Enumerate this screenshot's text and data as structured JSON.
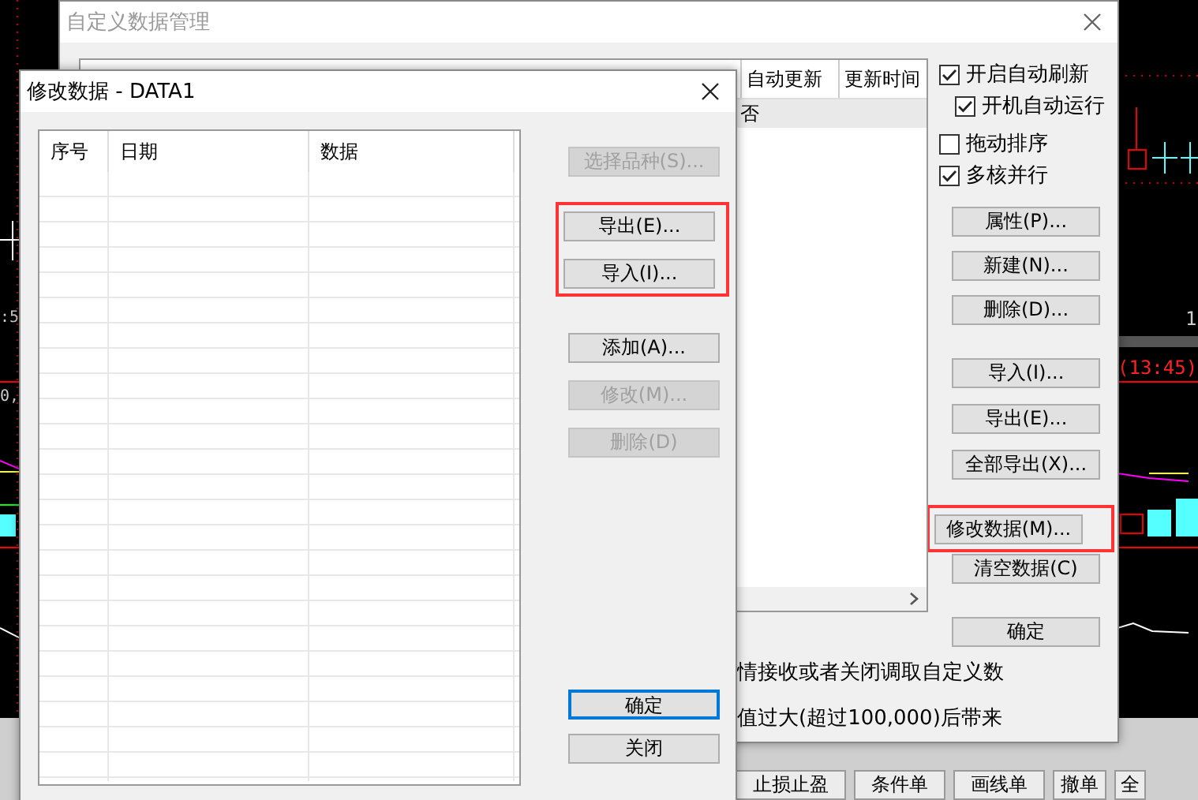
{
  "chart_left": {
    "texts": [
      ":5",
      "0,"
    ]
  },
  "chart_right": {
    "texts": [
      "1",
      "(13:45)"
    ]
  },
  "manager": {
    "title": "自定义数据管理",
    "list": {
      "columns": [
        "自动更新",
        "更新时间"
      ],
      "rows": [
        {
          "cells": [
            "否"
          ],
          "selected": true
        }
      ]
    },
    "options": [
      {
        "label": "开启自动刷新",
        "checked": true,
        "indented": false
      },
      {
        "label": "开机自动运行",
        "checked": true,
        "indented": true
      },
      {
        "label": "拖动排序",
        "checked": false,
        "indented": false
      },
      {
        "label": "多核并行",
        "checked": true,
        "indented": false
      }
    ],
    "button_groups": [
      {
        "highlighted": false,
        "buttons": [
          {
            "label": "属性(P)..."
          },
          {
            "label": "新建(N)..."
          },
          {
            "label": "删除(D)..."
          }
        ]
      },
      {
        "highlighted": false,
        "buttons": [
          {
            "label": "导入(I)..."
          },
          {
            "label": "导出(E)..."
          },
          {
            "label": "全部导出(X)..."
          }
        ]
      },
      {
        "highlighted": true,
        "buttons": [
          {
            "label": "修改数据(M)..."
          }
        ]
      },
      {
        "highlighted": false,
        "buttons": [
          {
            "label": "清空数据(C)"
          }
        ]
      },
      {
        "highlighted": false,
        "buttons": [
          {
            "label": "确定"
          }
        ]
      }
    ],
    "notes": [
      "情接收或者关闭调取自定义数",
      "值过大(超过100,000)后带来"
    ]
  },
  "editor": {
    "title": "修改数据 - DATA1",
    "columns": [
      "序号",
      "日期",
      "数据"
    ],
    "button_groups": [
      {
        "highlighted": false,
        "buttons": [
          {
            "label": "选择品种(S)...",
            "disabled": true,
            "focused": false
          }
        ]
      },
      {
        "highlighted": true,
        "buttons": [
          {
            "label": "导出(E)...",
            "disabled": false,
            "focused": false
          },
          {
            "label": "导入(I)...",
            "disabled": false,
            "focused": false
          }
        ]
      },
      {
        "highlighted": false,
        "buttons": [
          {
            "label": "添加(A)...",
            "disabled": false,
            "focused": false
          },
          {
            "label": "修改(M)...",
            "disabled": true,
            "focused": false
          },
          {
            "label": "删除(D)",
            "disabled": true,
            "focused": false
          }
        ]
      },
      {
        "highlighted": false,
        "buttons": [
          {
            "label": "确定",
            "disabled": false,
            "focused": true
          },
          {
            "label": "关闭",
            "disabled": false,
            "focused": false
          }
        ]
      }
    ]
  },
  "bottom_toolbar": [
    "止损止盈",
    "条件单",
    "画线单",
    "撤单",
    "全"
  ]
}
